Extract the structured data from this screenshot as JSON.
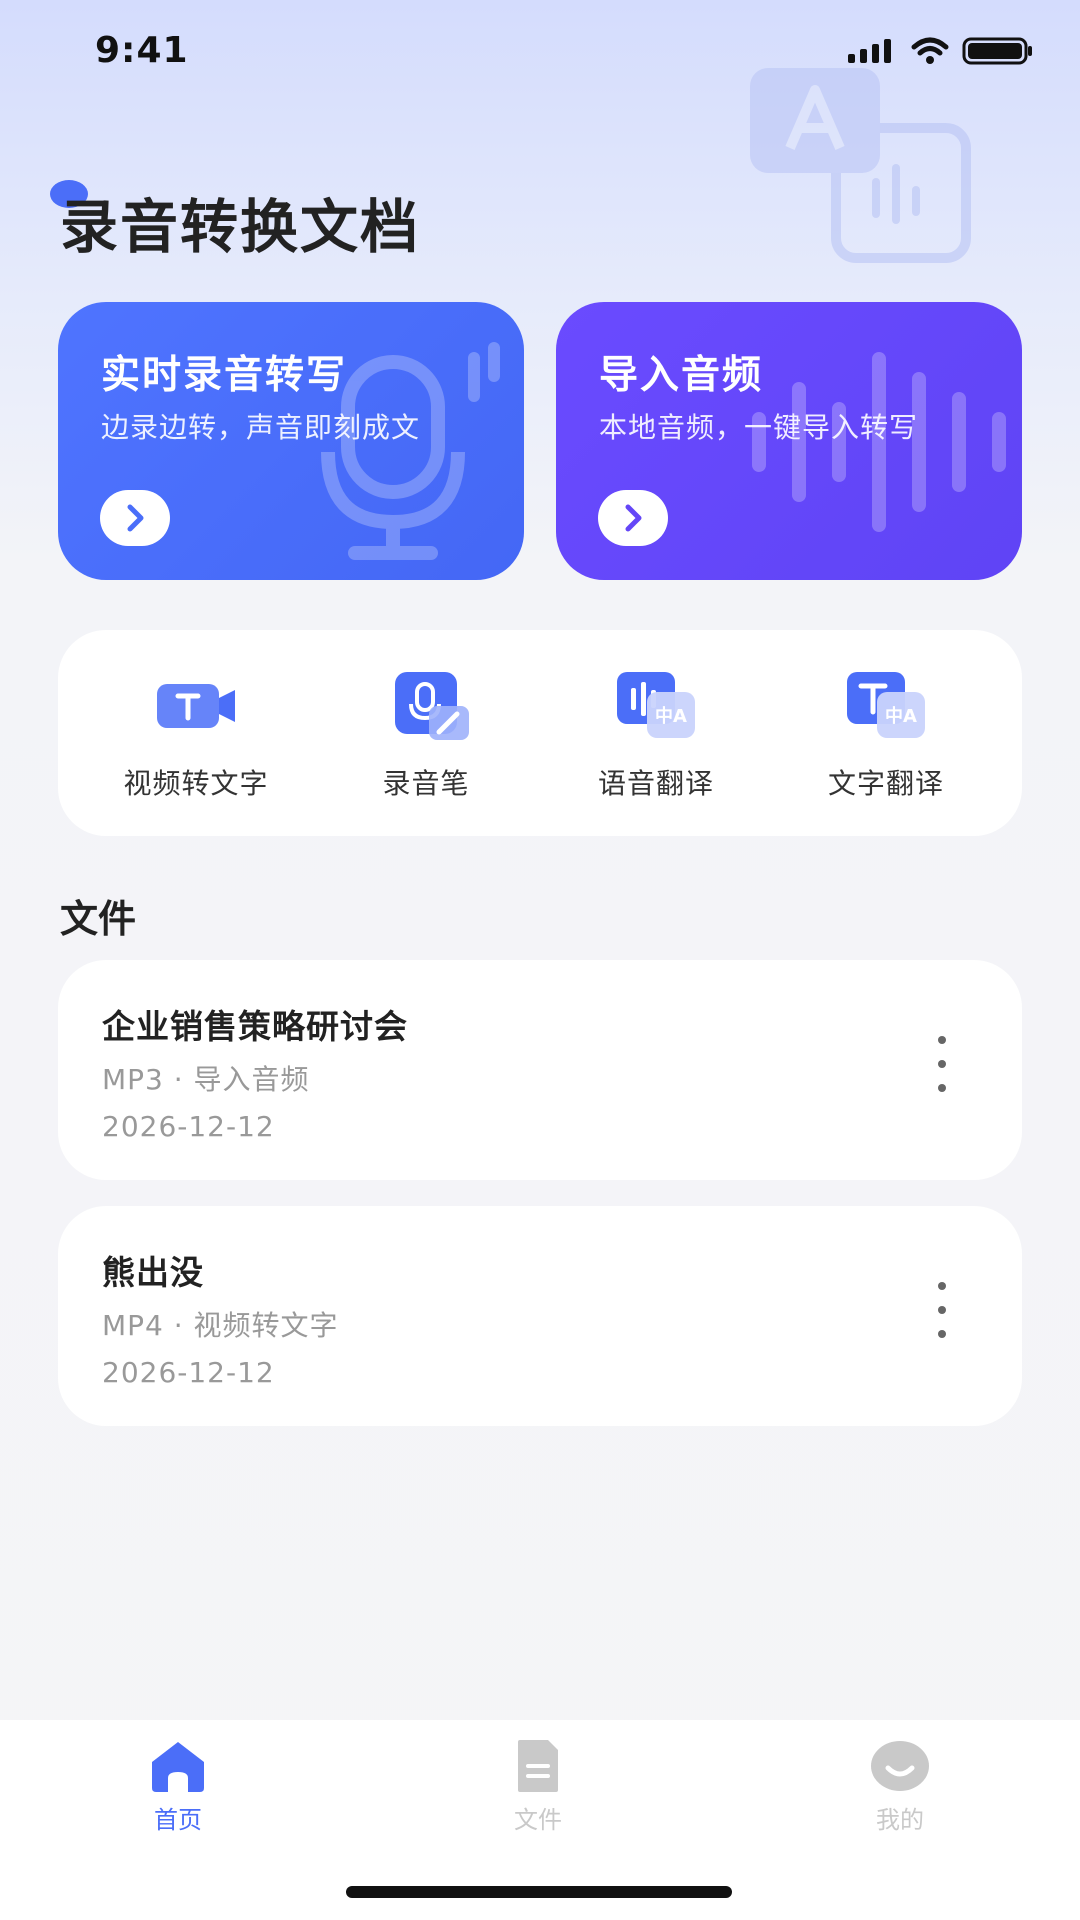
{
  "status_bar": {
    "time": "9:41"
  },
  "header": {
    "title": "录音转换文档"
  },
  "cards": [
    {
      "title": "实时录音转写",
      "subtitle": "边录边转，声音即刻成文",
      "color": "#4a6ef9"
    },
    {
      "title": "导入音频",
      "subtitle": "本地音频，一键导入转写",
      "color": "#6446f7"
    }
  ],
  "tools": [
    {
      "label": "视频转文字",
      "icon": "video-text-icon"
    },
    {
      "label": "录音笔",
      "icon": "recorder-pen-icon"
    },
    {
      "label": "语音翻译",
      "icon": "voice-translate-icon"
    },
    {
      "label": "文字翻译",
      "icon": "text-translate-icon"
    }
  ],
  "files_section": {
    "title": "文件"
  },
  "files": [
    {
      "name": "企业销售策略研讨会",
      "meta": "MP3 · 导入音频",
      "date": "2026-12-12"
    },
    {
      "name": "熊出没",
      "meta": "MP4 · 视频转文字",
      "date": "2026-12-12"
    }
  ],
  "tabbar": {
    "items": [
      {
        "label": "首页",
        "icon": "home-icon",
        "active": true
      },
      {
        "label": "文件",
        "icon": "document-icon",
        "active": false
      },
      {
        "label": "我的",
        "icon": "profile-icon",
        "active": false
      }
    ],
    "active_color": "#4b6ef8",
    "inactive_color": "#c9c9c9"
  }
}
